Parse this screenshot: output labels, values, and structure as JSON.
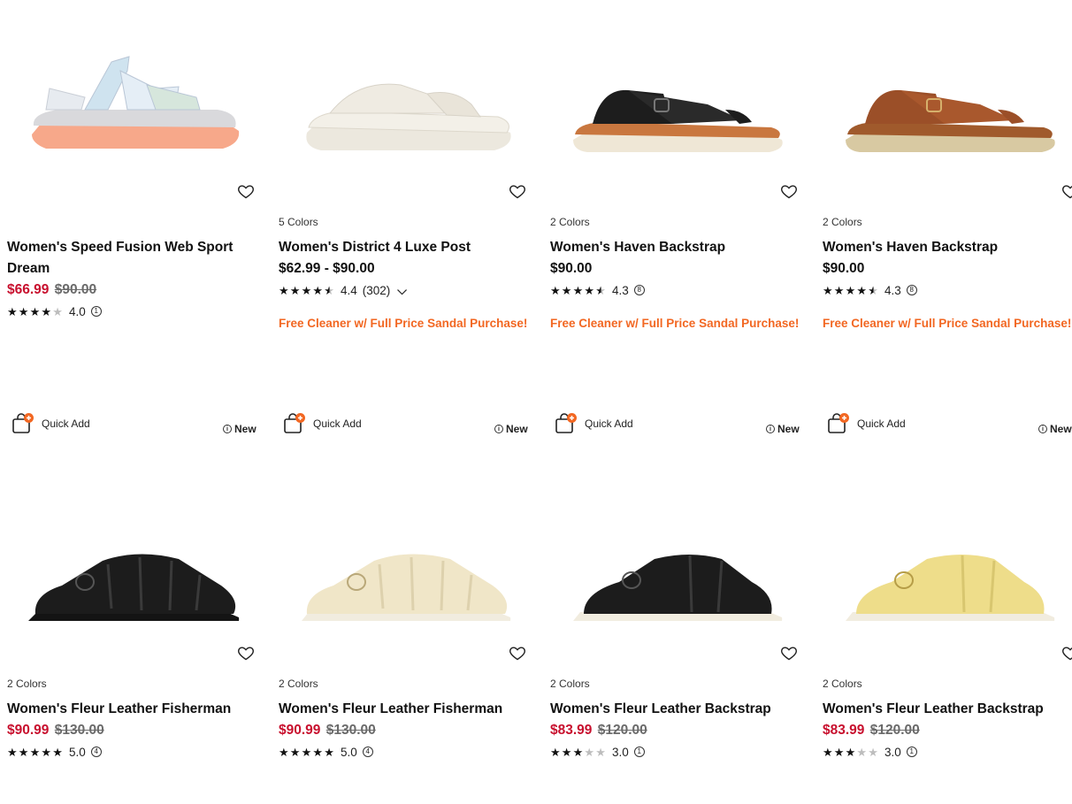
{
  "products": [
    {
      "colors": "",
      "title": "Women's Speed Fusion Web Sport Dream",
      "price_sale": "$66.99",
      "price_original": "$90.00",
      "price_regular": "",
      "rating": "4.0",
      "review_count": "1",
      "rating_value": 4.0,
      "promo": ""
    },
    {
      "colors": "5 Colors",
      "title": "Women's District 4 Luxe Post",
      "price_sale": "",
      "price_original": "",
      "price_regular": "$62.99 - $90.00",
      "rating": "4.4",
      "review_count": "(302)",
      "rating_value": 4.4,
      "promo": "Free Cleaner w/ Full Price Sandal Purchase!"
    },
    {
      "colors": "2 Colors",
      "title": "Women's Haven Backstrap",
      "price_sale": "",
      "price_original": "",
      "price_regular": "$90.00",
      "rating": "4.3",
      "review_count": "8",
      "rating_value": 4.3,
      "promo": "Free Cleaner w/ Full Price Sandal Purchase!"
    },
    {
      "colors": "2 Colors",
      "title": "Women's Haven Backstrap",
      "price_sale": "",
      "price_original": "",
      "price_regular": "$90.00",
      "rating": "4.3",
      "review_count": "8",
      "rating_value": 4.3,
      "promo": "Free Cleaner w/ Full Price Sandal Purchase!"
    },
    {
      "colors": "2 Colors",
      "title": "Women's Fleur Leather Fisherman",
      "price_sale": "$90.99",
      "price_original": "$130.00",
      "price_regular": "",
      "rating": "5.0",
      "review_count": "4",
      "rating_value": 5.0,
      "promo": ""
    },
    {
      "colors": "2 Colors",
      "title": "Women's Fleur Leather Fisherman",
      "price_sale": "$90.99",
      "price_original": "$130.00",
      "price_regular": "",
      "rating": "5.0",
      "review_count": "4",
      "rating_value": 5.0,
      "promo": ""
    },
    {
      "colors": "2 Colors",
      "title": "Women's Fleur Leather Backstrap",
      "price_sale": "$83.99",
      "price_original": "$120.00",
      "price_regular": "",
      "rating": "3.0",
      "review_count": "1",
      "rating_value": 3.0,
      "promo": ""
    },
    {
      "colors": "2 Colors",
      "title": "Women's Fleur Leather Backstrap",
      "price_sale": "$83.99",
      "price_original": "$120.00",
      "price_regular": "",
      "rating": "3.0",
      "review_count": "1",
      "rating_value": 3.0,
      "promo": ""
    }
  ],
  "quick_add_label": "Quick Add",
  "new_label": "New",
  "colors": {
    "sale": "#c8102e",
    "promo": "#f26722",
    "quick_add_accent": "#f26722"
  },
  "icons": {
    "wishlist": "heart-outline-icon",
    "quick_add": "bag-plus-icon",
    "info": "info-circle-icon",
    "dropdown": "chevron-down-icon"
  }
}
